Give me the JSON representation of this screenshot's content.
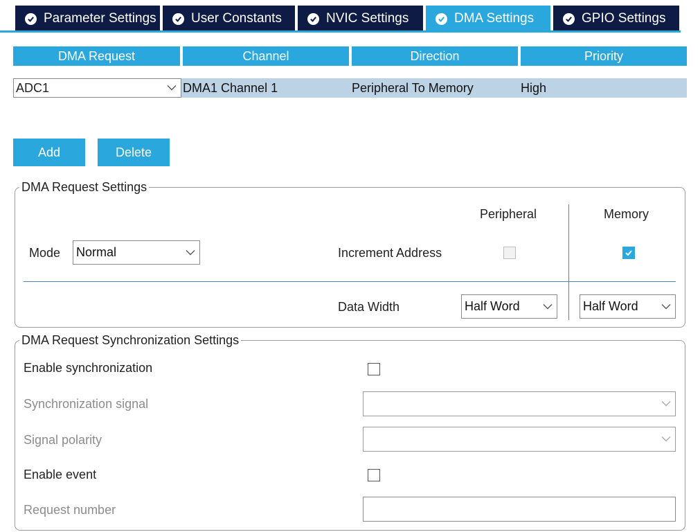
{
  "tabs": [
    {
      "label": "Parameter Settings",
      "active": false
    },
    {
      "label": "User Constants",
      "active": false
    },
    {
      "label": "NVIC Settings",
      "active": false
    },
    {
      "label": "DMA Settings",
      "active": true
    },
    {
      "label": "GPIO Settings",
      "active": false
    }
  ],
  "table": {
    "headers": [
      "DMA Request",
      "Channel",
      "Direction",
      "Priority"
    ],
    "rows": [
      {
        "request": "ADC1",
        "channel": "DMA1 Channel 1",
        "direction": "Peripheral To Memory",
        "priority": "High"
      }
    ]
  },
  "buttons": {
    "add": "Add",
    "delete": "Delete"
  },
  "request_settings": {
    "legend": "DMA Request Settings",
    "peripheral_header": "Peripheral",
    "memory_header": "Memory",
    "mode_label": "Mode",
    "mode_value": "Normal",
    "increment_label": "Increment Address",
    "peripheral_increment": false,
    "memory_increment": true,
    "data_width_label": "Data Width",
    "peripheral_data_width": "Half Word",
    "memory_data_width": "Half Word"
  },
  "sync_settings": {
    "legend": "DMA Request Synchronization Settings",
    "enable_sync_label": "Enable synchronization",
    "enable_sync": false,
    "sync_signal_label": "Synchronization signal",
    "sync_signal_value": "",
    "polarity_label": "Signal polarity",
    "polarity_value": "",
    "enable_event_label": "Enable event",
    "enable_event": false,
    "request_number_label": "Request number",
    "request_number_value": ""
  },
  "colors": {
    "accent": "#2aa7dd",
    "tab_dark": "#0d1b45",
    "row_selected": "#bcd3e6"
  }
}
